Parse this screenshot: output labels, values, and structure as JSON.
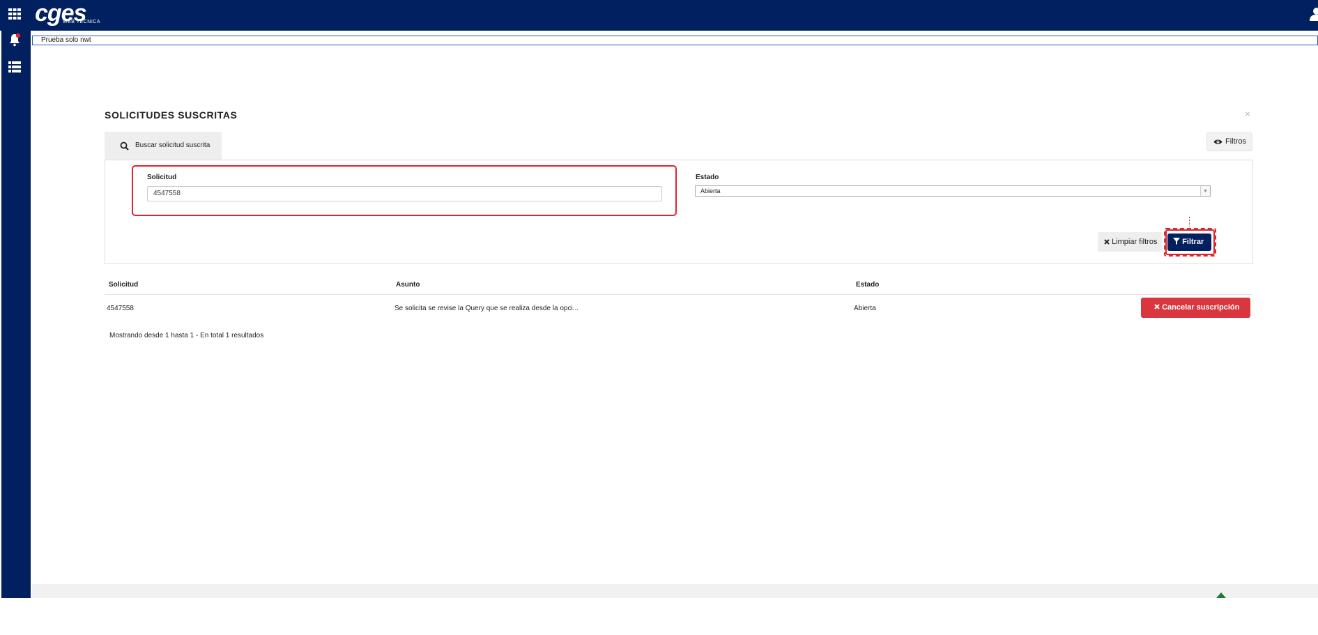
{
  "header": {
    "logo_text": "cges",
    "logo_subtitle": "WEB TECNICA"
  },
  "notice": {
    "text": "Prueba solo nwt"
  },
  "modal": {
    "title": "SOLICITUDES SUSCRITAS",
    "close_label": "×",
    "tab_label": "Buscar solicitud suscrita",
    "filtros_label": "Filtros"
  },
  "filters": {
    "solicitud_label": "Solicitud",
    "solicitud_value": "4547558",
    "estado_label": "Estado",
    "estado_value": "Abierta",
    "limpiar_label": "Limpiar filtros",
    "filtrar_label": "Filtrar"
  },
  "table": {
    "headers": [
      "Solicitud",
      "Asunto",
      "Estado"
    ],
    "rows": [
      {
        "solicitud": "4547558",
        "asunto": "Se solicita se revise la Query que se realiza desde la opci...",
        "estado": "Abierta",
        "action_label": "Cancelar suscripción"
      }
    ]
  },
  "summary": "Mostrando desde 1 hasta 1 - En total 1 resultados",
  "colors": {
    "navy": "#002060",
    "danger": "#d9363e",
    "highlight": "#e0242c"
  },
  "icons": [
    "apps-grid-icon",
    "bell-icon",
    "list-icon",
    "user-icon",
    "search-icon",
    "eye-icon",
    "close-x-icon",
    "filter-funnel-icon",
    "triangle-icon"
  ]
}
